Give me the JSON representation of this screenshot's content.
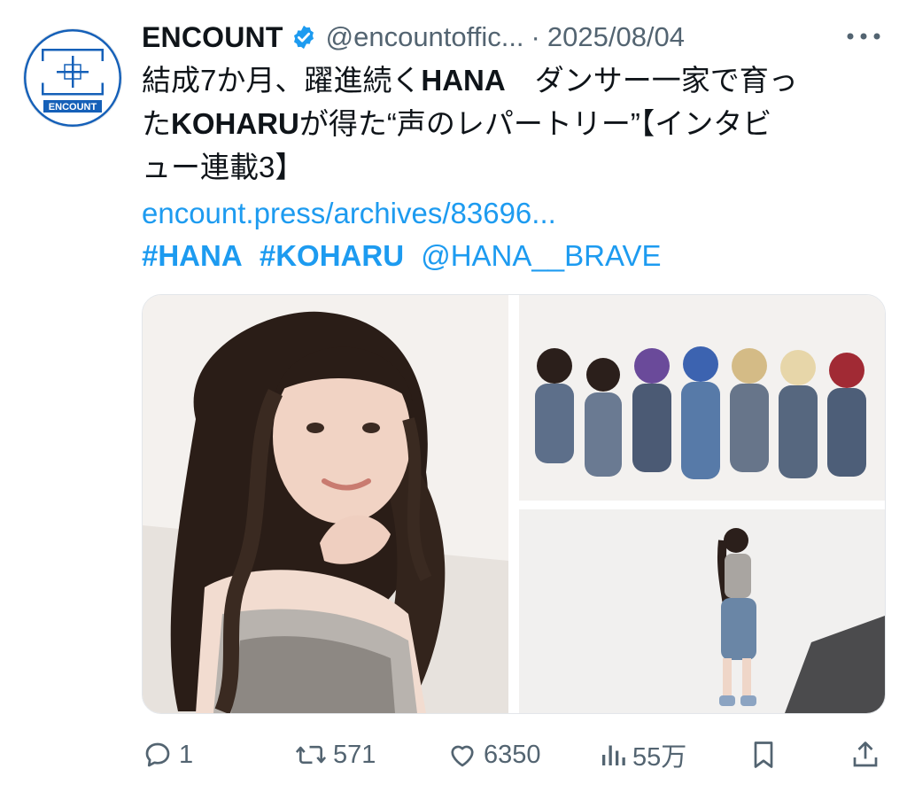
{
  "author": {
    "name": "ENCOUNT",
    "handle": "@encountoffic...",
    "separator": "·",
    "date": "2025/08/04",
    "avatar_text": "ENCOUNT"
  },
  "tweet": {
    "line1_prefix": "結成7か月、躍進続く",
    "line1_bold": "HANA",
    "line1_rest": "　ダンサー一家で育っ",
    "line2_prefix": "た",
    "line2_bold": "KOHARU",
    "line2_rest": "が得た“声のレパートリー”【インタビ",
    "line3": "ュー連載3】",
    "link": "encount.press/archives/83696...",
    "hashtags": [
      "#HANA",
      "#KOHARU"
    ],
    "mention": "@HANA__BRAVE"
  },
  "actions": {
    "replies": "1",
    "retweets": "571",
    "likes": "6350",
    "views": "55万"
  },
  "colors": {
    "link": "#1d9bf0",
    "secondary": "#536471",
    "verified": "#1d9bf0",
    "brand": "#1560b8"
  },
  "icons": [
    "verified-badge-icon",
    "more-icon",
    "reply-icon",
    "retweet-icon",
    "like-icon",
    "views-icon",
    "bookmark-icon",
    "share-icon"
  ]
}
